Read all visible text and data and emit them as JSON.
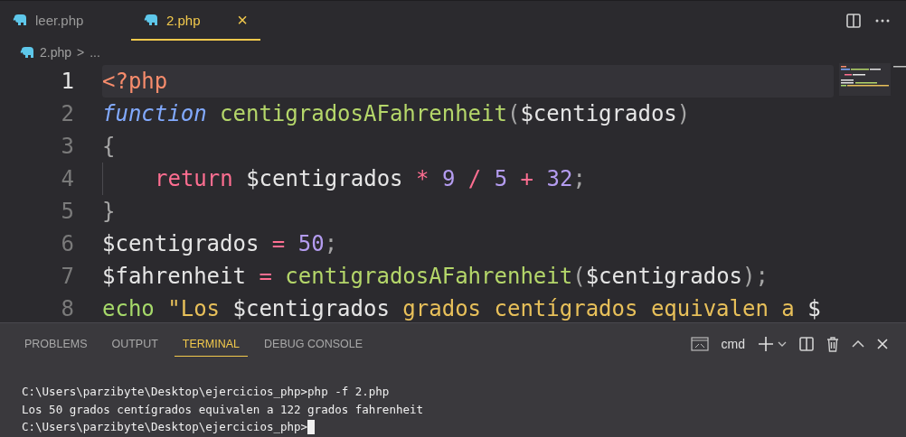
{
  "tabs": [
    {
      "label": "leer.php",
      "selected": false
    },
    {
      "label": "2.php",
      "selected": true,
      "close": "×"
    }
  ],
  "breadcrumb": {
    "file": "2.php",
    "separator": ">",
    "rest": "..."
  },
  "editor": {
    "lines": [
      {
        "number": "1",
        "active": true,
        "indented": false,
        "tokens": [
          {
            "text": "<?php",
            "kind": "tag"
          }
        ]
      },
      {
        "number": "2",
        "active": false,
        "indented": false,
        "tokens": [
          {
            "text": "function",
            "kind": "storage"
          },
          {
            "text": " centigradosAFahrenheit",
            "kind": "func"
          },
          {
            "text": "(",
            "kind": "punct"
          },
          {
            "text": "$centigrados",
            "kind": "var"
          },
          {
            "text": ")",
            "kind": "punct"
          }
        ]
      },
      {
        "number": "3",
        "active": false,
        "indented": false,
        "tokens": [
          {
            "text": "{",
            "kind": "punct"
          }
        ]
      },
      {
        "number": "4",
        "active": false,
        "indented": true,
        "tokens": [
          {
            "text": "return",
            "kind": "keyword"
          },
          {
            "text": " $centigrados",
            "kind": "var"
          },
          {
            "text": " *",
            "kind": "op"
          },
          {
            "text": " 9",
            "kind": "num"
          },
          {
            "text": " /",
            "kind": "op"
          },
          {
            "text": " 5",
            "kind": "num"
          },
          {
            "text": " +",
            "kind": "op"
          },
          {
            "text": " 32",
            "kind": "num"
          },
          {
            "text": ";",
            "kind": "punct"
          }
        ]
      },
      {
        "number": "5",
        "active": false,
        "indented": false,
        "tokens": [
          {
            "text": "}",
            "kind": "punct"
          }
        ]
      },
      {
        "number": "6",
        "active": false,
        "indented": false,
        "tokens": [
          {
            "text": "$centigrados",
            "kind": "var"
          },
          {
            "text": " =",
            "kind": "op"
          },
          {
            "text": " 50",
            "kind": "num"
          },
          {
            "text": ";",
            "kind": "punct"
          }
        ]
      },
      {
        "number": "7",
        "active": false,
        "indented": false,
        "tokens": [
          {
            "text": "$fahrenheit",
            "kind": "var"
          },
          {
            "text": " =",
            "kind": "op"
          },
          {
            "text": " centigradosAFahrenheit",
            "kind": "func"
          },
          {
            "text": "(",
            "kind": "punct"
          },
          {
            "text": "$centigrados",
            "kind": "var"
          },
          {
            "text": ");",
            "kind": "punct"
          }
        ]
      },
      {
        "number": "8",
        "active": false,
        "indented": false,
        "tokens": [
          {
            "text": "echo",
            "kind": "builtin"
          },
          {
            "text": " \"Los ",
            "kind": "string"
          },
          {
            "text": "$centigrados",
            "kind": "var"
          },
          {
            "text": " grados centígrados equivalen a ",
            "kind": "string"
          },
          {
            "text": "$",
            "kind": "var"
          }
        ]
      }
    ]
  },
  "panel": {
    "tabs": [
      {
        "label": "PROBLEMS",
        "selected": false
      },
      {
        "label": "OUTPUT",
        "selected": false
      },
      {
        "label": "TERMINAL",
        "selected": true
      },
      {
        "label": "DEBUG CONSOLE",
        "selected": false
      }
    ],
    "shell": "cmd",
    "terminal": [
      "C:\\Users\\parzibyte\\Desktop\\ejercicios_php>php -f 2.php",
      "Los 50 grados centígrados equivalen a 122 grados fahrenheit",
      "C:\\Users\\parzibyte\\Desktop\\ejercicios_php>"
    ]
  }
}
